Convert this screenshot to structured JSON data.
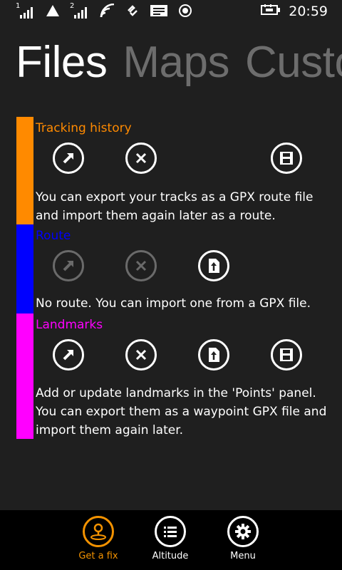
{
  "status": {
    "time": "20:59",
    "sim1": "1",
    "sim2": "2"
  },
  "pivot": {
    "items": [
      "Files",
      "Maps",
      "Custo"
    ],
    "active": "Files"
  },
  "colors": {
    "tracking": "#ff8a00",
    "route": "#0000ff",
    "landmarks": "#ff00ff",
    "accent": "#f39200"
  },
  "sections": {
    "tracking": {
      "title": "Tracking history",
      "text_line1": "You can export your tracks as a GPX route file",
      "text_line2": "and import them again later as a route."
    },
    "route": {
      "title": "Route",
      "text_line1": "No route. You can import one from a GPX file."
    },
    "landmarks": {
      "title": "Landmarks",
      "text_line1": "Add or update landmarks in the 'Points' panel.",
      "text_line2": "You can export them as a waypoint GPX file and",
      "text_line3": "import them again later."
    }
  },
  "appbar": {
    "getfix": "Get a fix",
    "altitude": "Altitude",
    "menu": "Menu"
  }
}
